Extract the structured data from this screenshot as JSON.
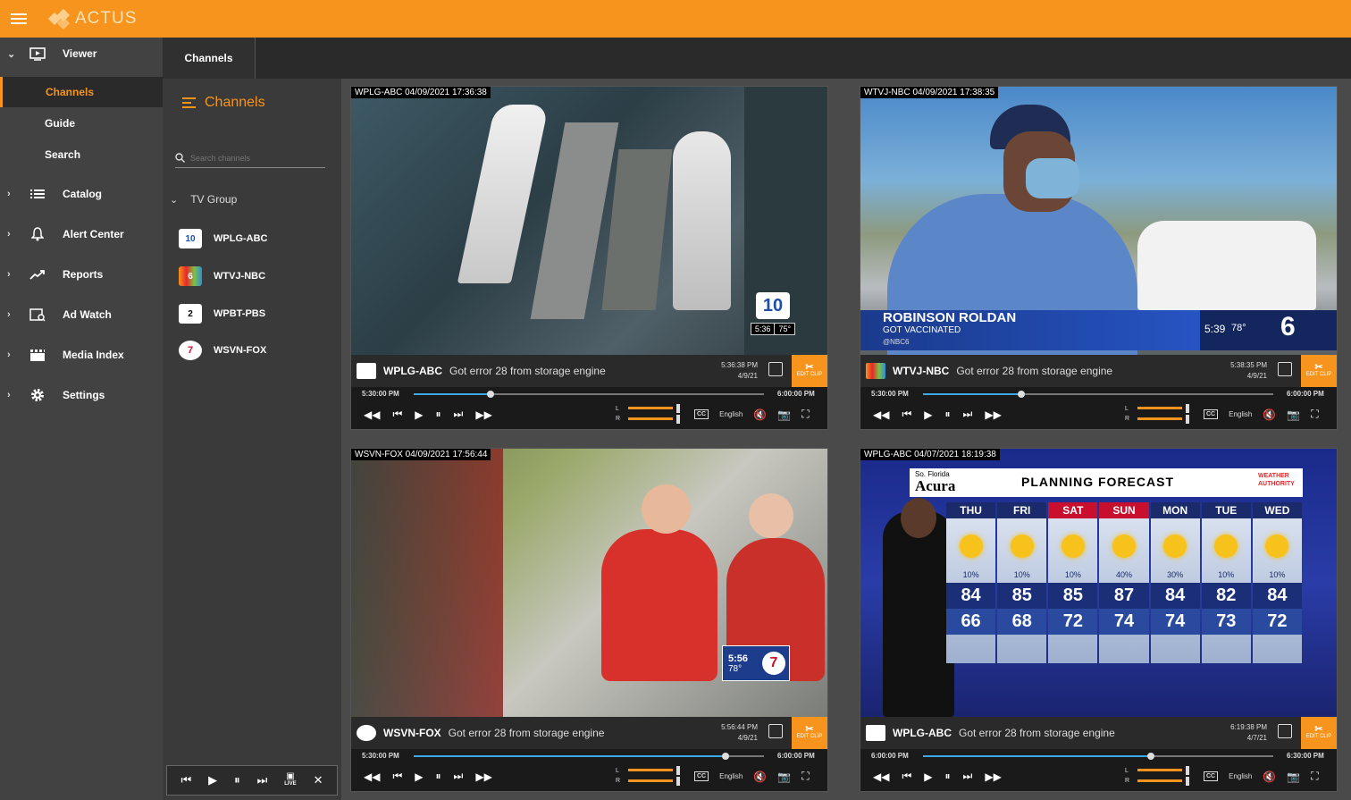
{
  "app": {
    "name": "ACTUS"
  },
  "sidebar": {
    "viewer_label": "Viewer",
    "subitems": [
      {
        "label": "Channels",
        "active": true
      },
      {
        "label": "Guide",
        "active": false
      },
      {
        "label": "Search",
        "active": false
      }
    ],
    "items": [
      {
        "label": "Catalog",
        "icon": "list-icon"
      },
      {
        "label": "Alert Center",
        "icon": "bell-icon"
      },
      {
        "label": "Reports",
        "icon": "trend-icon"
      },
      {
        "label": "Ad Watch",
        "icon": "ad-watch-icon"
      },
      {
        "label": "Media Index",
        "icon": "clapper-icon"
      },
      {
        "label": "Settings",
        "icon": "gear-icon"
      }
    ]
  },
  "tabbar": {
    "tab_label": "Channels"
  },
  "channel_panel": {
    "title": "Channels",
    "search_placeholder": "Search channels",
    "group_label": "TV Group",
    "channels": [
      {
        "name": "WPLG-ABC",
        "logo_text": "10"
      },
      {
        "name": "WTVJ-NBC",
        "logo_text": "6"
      },
      {
        "name": "WPBT-PBS",
        "logo_text": "2"
      },
      {
        "name": "WSVN-FOX",
        "logo_text": "7"
      }
    ],
    "live_label": "LIVE"
  },
  "players": [
    {
      "stamp": "WPLG-ABC  04/09/2021 17:36:38",
      "channel": "WPLG-ABC",
      "message": "Got error 28 from storage engine",
      "clip_time": "5:36:38 PM",
      "clip_date": "4/9/21",
      "start": "5:30:00 PM",
      "end": "6:00:00 PM",
      "progress": 0.22,
      "language": "English",
      "edit_label": "EDIT CLIP",
      "overlay": {
        "time": "5:36",
        "temp": "75°"
      }
    },
    {
      "stamp": "WTVJ-NBC  04/09/2021 17:38:35",
      "channel": "WTVJ-NBC",
      "message": "Got error 28 from storage engine",
      "clip_time": "5:38:35 PM",
      "clip_date": "4/9/21",
      "start": "5:30:00 PM",
      "end": "6:00:00 PM",
      "progress": 0.28,
      "language": "English",
      "edit_label": "EDIT CLIP",
      "overlay": {
        "name": "ROBINSON ROLDAN",
        "sub": "GOT VACCINATED",
        "handle": "@NBC6",
        "time": "5:39",
        "temp": "78°",
        "channel_num": "6"
      }
    },
    {
      "stamp": "WSVN-FOX  04/09/2021 17:56:44",
      "channel": "WSVN-FOX",
      "message": "Got error 28 from storage engine",
      "clip_time": "5:56:44 PM",
      "clip_date": "4/9/21",
      "start": "5:30:00 PM",
      "end": "6:00:00 PM",
      "progress": 0.89,
      "language": "English",
      "edit_label": "EDIT CLIP",
      "overlay": {
        "time": "5:56",
        "temp": "78°",
        "channel_num": "7"
      }
    },
    {
      "stamp": "WPLG-ABC  04/07/2021 18:19:38",
      "channel": "WPLG-ABC",
      "message": "Got error 28 from storage engine",
      "clip_time": "6:19:38 PM",
      "clip_date": "4/7/21",
      "start": "6:00:00 PM",
      "end": "6:30:00 PM",
      "progress": 0.65,
      "language": "English",
      "edit_label": "EDIT CLIP",
      "overlay": {
        "sponsor_top": "So. Florida",
        "sponsor": "Acura",
        "headline": "PLANNING FORECAST",
        "brand": "WEATHER AUTHORITY",
        "days": [
          "THU",
          "FRI",
          "SAT",
          "SUN",
          "MON",
          "TUE",
          "WED"
        ],
        "chance": [
          "10%",
          "10%",
          "10%",
          "40%",
          "30%",
          "10%",
          "10%"
        ],
        "highs": [
          "84",
          "85",
          "85",
          "87",
          "84",
          "82",
          "84"
        ],
        "lows": [
          "66",
          "68",
          "72",
          "74",
          "74",
          "73",
          "72"
        ]
      }
    }
  ],
  "colors": {
    "accent": "#f7941d",
    "progress": "#3ba8e8"
  }
}
